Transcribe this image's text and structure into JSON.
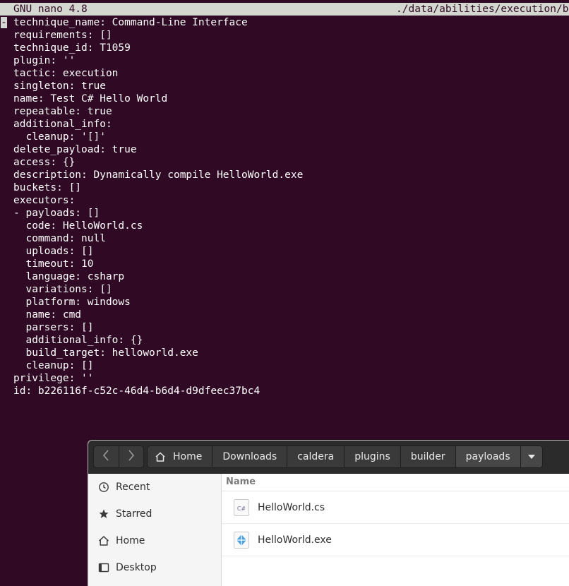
{
  "nano": {
    "title": "GNU nano 4.8",
    "path": "./data/abilities/execution/b",
    "cursor_char": "-",
    "lines": [
      "technique_name: Command-Line Interface",
      "requirements: []",
      "technique_id: T1059",
      "plugin: ''",
      "tactic: execution",
      "singleton: true",
      "name: Test C# Hello World",
      "repeatable: true",
      "additional_info:",
      "  cleanup: '[]'",
      "delete_payload: true",
      "access: {}",
      "description: Dynamically compile HelloWorld.exe",
      "buckets: []",
      "executors:",
      "- payloads: []",
      "  code: HelloWorld.cs",
      "  command: null",
      "  uploads: []",
      "  timeout: 10",
      "  language: csharp",
      "  variations: []",
      "  platform: windows",
      "  name: cmd",
      "  parsers: []",
      "  additional_info: {}",
      "  build_target: helloworld.exe",
      "  cleanup: []",
      "privilege: ''",
      "id: b226116f-c52c-46d4-b6d4-d9dfeec37bc4"
    ]
  },
  "file_manager": {
    "nav": {
      "back_icon": "chevron-left-icon",
      "forward_icon": "chevron-right-icon"
    },
    "breadcrumb": [
      "Home",
      "Downloads",
      "caldera",
      "plugins",
      "builder",
      "payloads"
    ],
    "sidebar": [
      {
        "label": "Recent",
        "icon": "clock-icon"
      },
      {
        "label": "Starred",
        "icon": "star-icon"
      },
      {
        "label": "Home",
        "icon": "home-icon"
      },
      {
        "label": "Desktop",
        "icon": "desktop-icon"
      }
    ],
    "column_header": "Name",
    "files": [
      {
        "name": "HelloWorld.cs",
        "icon": "csharp-file-icon",
        "icon_text": "C#"
      },
      {
        "name": "HelloWorld.exe",
        "icon": "executable-file-icon"
      }
    ]
  },
  "colors": {
    "terminal_bg": "#300a24",
    "nano_bar": "#d3d7cf",
    "fm_header": "#2b2b2b"
  }
}
